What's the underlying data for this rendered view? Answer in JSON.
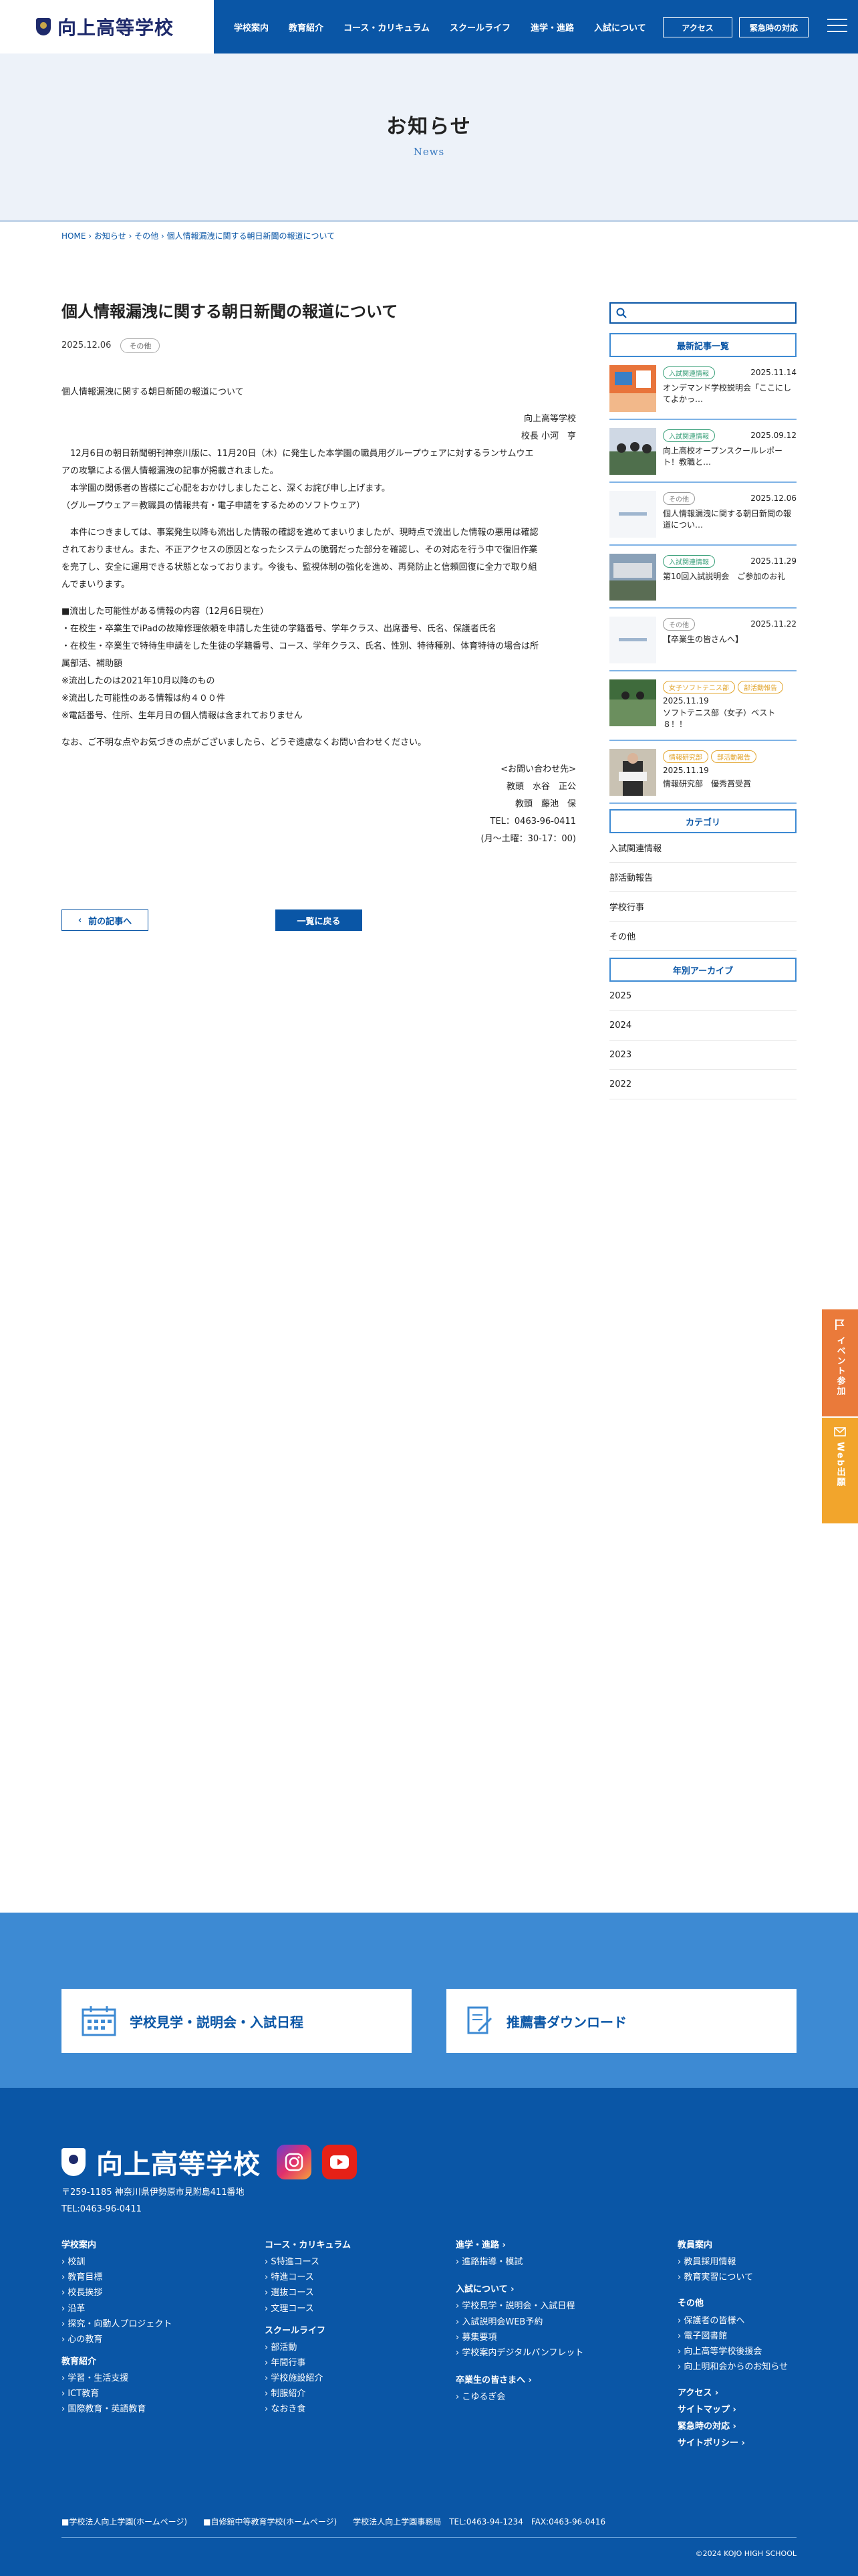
{
  "header": {
    "logo": "向上高等学校",
    "nav": [
      "学校案内",
      "教育紹介",
      "コース・カリキュラム",
      "スクールライフ",
      "進学・進路",
      "入試について"
    ],
    "access": "アクセス",
    "emergency": "緊急時の対応"
  },
  "page_head": {
    "title": "お知らせ",
    "subtitle": "News"
  },
  "breadcrumb": [
    "HOME",
    "お知らせ",
    "その他",
    "個人情報漏洩に関する朝日新聞の報道について"
  ],
  "article": {
    "title": "個人情報漏洩に関する朝日新聞の報道について",
    "date": "2025.12.06",
    "category": "その他",
    "intro": "個人情報漏洩に関する朝日新聞の報道について",
    "sig1": "向上高等学校",
    "sig2": "校長 小河　亨",
    "p1": [
      "12月6日の朝日新聞朝刊神奈川版に、11月20日（木）に発生した本学園の職員用グループウェアに対するランサムウエ",
      "アの攻撃による個人情報漏洩の記事が掲載されました。",
      "本学園の関係者の皆様にご心配をおかけしましたこと、深くお詫び申し上げます。",
      "（グループウェア＝教職員の情報共有・電子申請をするためのソフトウェア）"
    ],
    "p2": [
      "本件につきましては、事案発生以降も流出した情報の確認を進めてまいりましたが、現時点で流出した情報の悪用は確認",
      "されておりません。また、不正アクセスの原因となったシステムの脆弱だった部分を確認し、その対応を行う中で復旧作業",
      "を完了し、安全に運用できる状態となっております。今後も、監視体制の強化を進め、再発防止と信頼回復に全力で取り組",
      "んでまいります。"
    ],
    "p3": [
      "■流出した可能性がある情報の内容（12月6日現在）",
      "・在校生・卒業生でiPadの故障修理依頼を申請した生徒の学籍番号、学年クラス、出席番号、氏名、保護者氏名",
      "・在校生・卒業生で特待生申請をした生徒の学籍番号、コース、学年クラス、氏名、性別、特待種別、体育特待の場合は所",
      "属部活、補助額",
      "※流出したのは2021年10月以降のもの",
      "※流出した可能性のある情報は約４００件",
      "※電話番号、住所、生年月日の個人情報は含まれておりません"
    ],
    "p4": "なお、ご不明な点やお気づきの点がございましたら、どうぞ遠慮なくお問い合わせください。",
    "contact": [
      "<お問い合わせ先>",
      "教頭　水谷　正公",
      "教頭　藤池　保",
      "TEL：0463-96-0411",
      "(月～土曜：30-17：00)"
    ]
  },
  "pager": {
    "prev": "前の記事へ",
    "list": "一覧に戻る"
  },
  "sidebar": {
    "latest_heading": "最新記事一覧",
    "posts": [
      {
        "cats": [
          "入試関連情報"
        ],
        "date": "2025.11.14",
        "title": "オンデマンド学校説明会「ここにしてよかっ…"
      },
      {
        "cats": [
          "入試関連情報"
        ],
        "date": "2025.09.12",
        "title": "向上高校オープンスクールレポート！教職と…"
      },
      {
        "cats": [
          "その他"
        ],
        "date": "2025.12.06",
        "title": "個人情報漏洩に関する朝日新聞の報道につい…"
      },
      {
        "cats": [
          "入試関連情報"
        ],
        "date": "2025.11.29",
        "title": "第10回入試説明会　ご参加のお礼"
      },
      {
        "cats": [
          "その他"
        ],
        "date": "2025.11.22",
        "title": "【卒業生の皆さんへ】"
      },
      {
        "cats": [
          "女子ソフトテニス部",
          "部活動報告"
        ],
        "date": "2025.11.19",
        "title": "ソフトテニス部（女子）ベスト８！！"
      },
      {
        "cats": [
          "情報研究部",
          "部活動報告"
        ],
        "date": "2025.11.19",
        "title": "情報研究部　優秀賞受賞"
      }
    ],
    "category_heading": "カテゴリ",
    "categories": [
      "入試関連情報",
      "部活動報告",
      "学校行事",
      "その他"
    ],
    "archive_heading": "年別アーカイブ",
    "years": [
      "2025",
      "2024",
      "2023",
      "2022"
    ]
  },
  "fixed_tabs": {
    "event": "イベント参加",
    "web": "Web出願"
  },
  "cta": {
    "visit": "学校見学・説明会・入試日程",
    "download": "推薦書ダウンロード"
  },
  "footer": {
    "logo": "向上高等学校",
    "address": "〒259-1185 神奈川県伊勢原市見附島411番地",
    "tel": "TEL:0463-96-0411",
    "col1": {
      "h1": "学校案内",
      "i1": [
        "校訓",
        "教育目標",
        "校長挨拶",
        "沿革",
        "探究・向動人プロジェクト",
        "心の教育"
      ],
      "h2": "教育紹介",
      "i2": [
        "学習・生活支援",
        "ICT教育",
        "国際教育・英語教育"
      ]
    },
    "col2": {
      "h1": "コース・カリキュラム",
      "i1": [
        "S特進コース",
        "特進コース",
        "選抜コース",
        "文理コース"
      ],
      "h2": "スクールライフ",
      "i2": [
        "部活動",
        "年間行事",
        "学校施設紹介",
        "制服紹介",
        "なおき食"
      ]
    },
    "col3": {
      "h1": "進学・進路",
      "i1": [
        "進路指導・模試"
      ],
      "h2": "入試について",
      "i2": [
        "学校見学・説明会・入試日程",
        "入試説明会WEB予約",
        "募集要項",
        "学校案内デジタルパンフレット"
      ],
      "h3": "卒業生の皆さまへ",
      "i3": [
        "こゆるぎ会"
      ]
    },
    "col4": {
      "h1": "教員案内",
      "i1": [
        "教員採用情報",
        "教育実習について"
      ],
      "h2": "その他",
      "i2": [
        "保護者の皆様へ",
        "電子図書館",
        "向上高等学校後援会",
        "向上明和会からのお知らせ"
      ],
      "links": [
        "アクセス",
        "サイトマップ",
        "緊急時の対応",
        "サイトポリシー"
      ]
    },
    "bottom": "■学校法人向上学園(ホームページ)　　■自修館中等教育学校(ホームページ)　　学校法人向上学園事務局　TEL:0463-94-1234　FAX:0463-96-0416",
    "copyright": "©2024 KOJO HIGH SCHOOL"
  }
}
